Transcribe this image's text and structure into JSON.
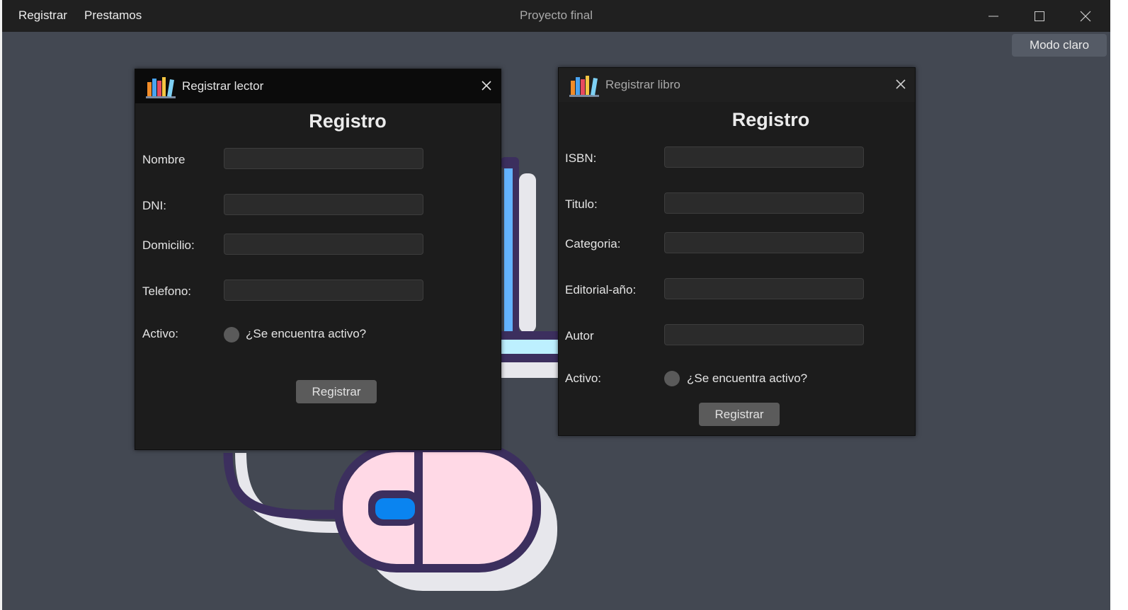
{
  "menu": {
    "items": [
      "Registrar",
      "Prestamos"
    ]
  },
  "app": {
    "title": "Proyecto final"
  },
  "mode_button": "Modo claro",
  "dialog_lector": {
    "title": "Registrar lector",
    "heading": "Registro",
    "fields": [
      {
        "label": "Nombre",
        "value": ""
      },
      {
        "label": "DNI:",
        "value": ""
      },
      {
        "label": "Domicilio:",
        "value": ""
      },
      {
        "label": "Telefono:",
        "value": ""
      }
    ],
    "active_label": "Activo:",
    "active_option": "¿Se encuentra activo?",
    "submit": "Registrar"
  },
  "dialog_libro": {
    "title": "Registrar libro",
    "heading": "Registro",
    "fields": [
      {
        "label": "ISBN:",
        "value": ""
      },
      {
        "label": "Titulo:",
        "value": ""
      },
      {
        "label": "Categoria:",
        "value": ""
      },
      {
        "label": "Editorial-año:",
        "value": ""
      },
      {
        "label": "Autor",
        "value": ""
      }
    ],
    "active_label": "Activo:",
    "active_option": "¿Se encuentra activo?",
    "submit": "Registrar"
  },
  "icons": {
    "minimize": "minimize-icon",
    "maximize": "maximize-icon",
    "close": "close-icon",
    "dialog": "books-icon"
  }
}
